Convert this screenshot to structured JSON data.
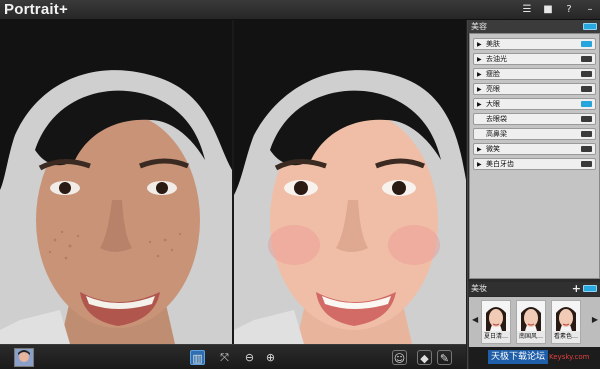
{
  "app": {
    "title": "Portrait+"
  },
  "window_controls": [
    {
      "icon": "list-icon",
      "glyph": "☰"
    },
    {
      "icon": "chat-icon",
      "glyph": "■"
    },
    {
      "icon": "help-icon",
      "glyph": "?"
    },
    {
      "icon": "minimize-icon",
      "glyph": "–"
    }
  ],
  "beauty": {
    "title": "美容",
    "items": [
      {
        "label": "美肤",
        "on": true
      },
      {
        "label": "去油光",
        "on": false
      },
      {
        "label": "瘦脸",
        "on": false
      },
      {
        "label": "亮眼",
        "on": false
      },
      {
        "label": "大眼",
        "on": true
      },
      {
        "label": "去眼袋",
        "on": false
      },
      {
        "label": "高鼻梁",
        "on": false
      },
      {
        "label": "微笑",
        "on": false
      },
      {
        "label": "美白牙齿",
        "on": false
      }
    ]
  },
  "makeup": {
    "title": "美妆",
    "add": "+",
    "presets": [
      {
        "label": "夏日清…"
      },
      {
        "label": "南国风…"
      },
      {
        "label": "看素色…"
      }
    ]
  },
  "footer": {
    "watermark": "天极下载论坛",
    "watermark_site": "Keysky.com"
  },
  "colors": {
    "accent": "#29a8e0",
    "toggle_on": "#26a4dc",
    "panel_bg": "#c4c4c4"
  }
}
